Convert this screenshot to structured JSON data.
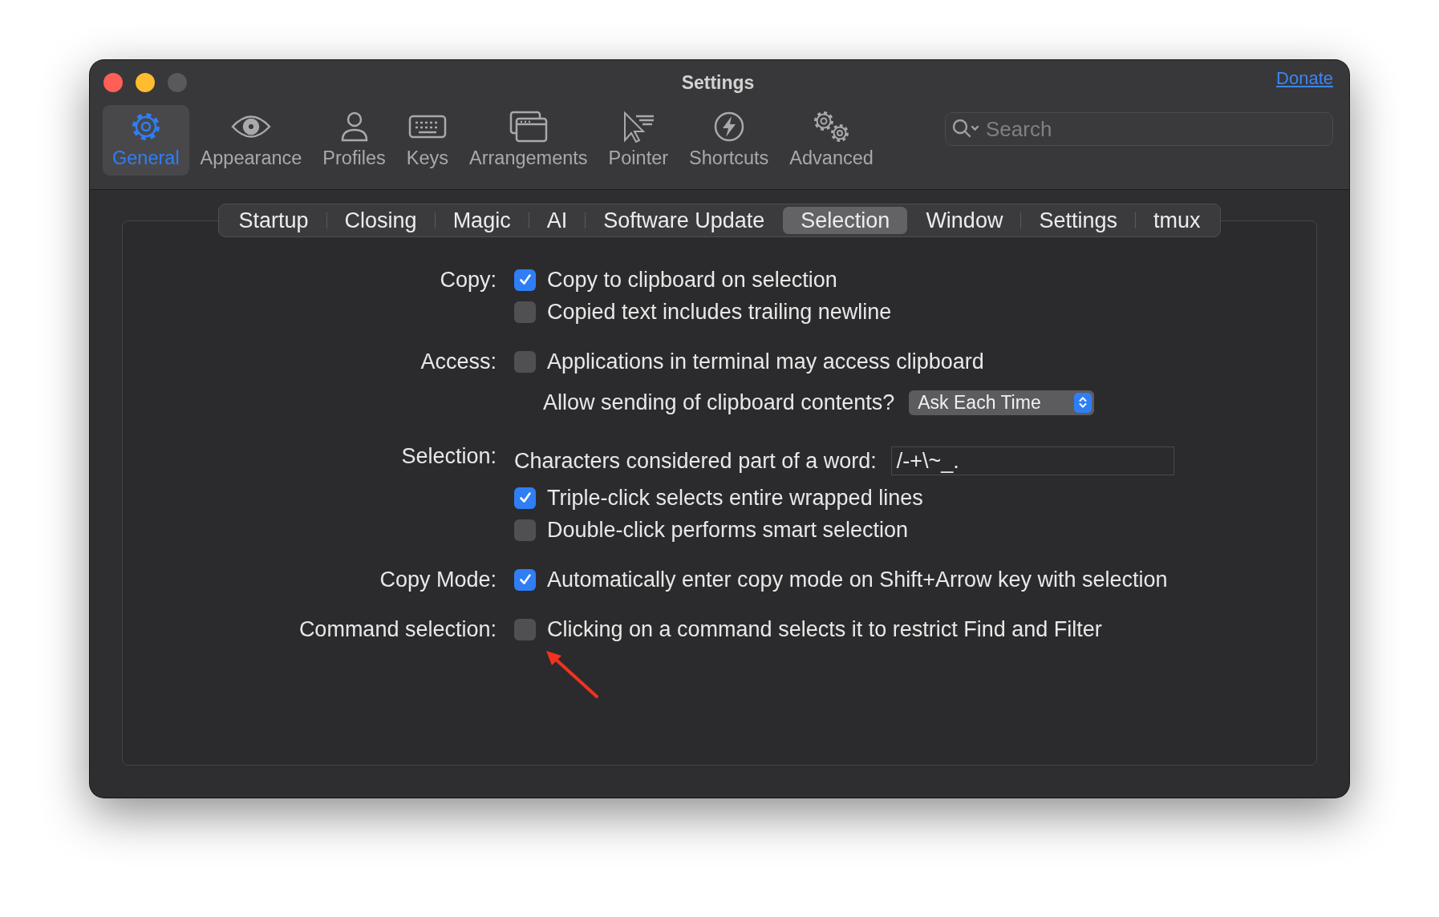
{
  "window": {
    "title": "Settings",
    "link": "Donate"
  },
  "toolbar": {
    "items": [
      {
        "label": "General",
        "selected": true
      },
      {
        "label": "Appearance",
        "selected": false
      },
      {
        "label": "Profiles",
        "selected": false
      },
      {
        "label": "Keys",
        "selected": false
      },
      {
        "label": "Arrangements",
        "selected": false
      },
      {
        "label": "Pointer",
        "selected": false
      },
      {
        "label": "Shortcuts",
        "selected": false
      },
      {
        "label": "Advanced",
        "selected": false
      }
    ],
    "search": {
      "placeholder": "Search"
    }
  },
  "tabs": [
    {
      "label": "Startup",
      "selected": false
    },
    {
      "label": "Closing",
      "selected": false
    },
    {
      "label": "Magic",
      "selected": false
    },
    {
      "label": "AI",
      "selected": false
    },
    {
      "label": "Software Update",
      "selected": false
    },
    {
      "label": "Selection",
      "selected": true
    },
    {
      "label": "Window",
      "selected": false
    },
    {
      "label": "Settings",
      "selected": false
    },
    {
      "label": "tmux",
      "selected": false
    }
  ],
  "sections": [
    {
      "label": "Copy:",
      "rows": [
        {
          "kind": "checkbox",
          "text": "Copy to clipboard on selection",
          "checked": true
        },
        {
          "kind": "checkbox",
          "text": "Copied text includes trailing newline",
          "checked": false
        }
      ]
    },
    {
      "label": "Access:",
      "rows": [
        {
          "kind": "checkbox",
          "text": "Applications in terminal may access clipboard",
          "checked": false
        },
        {
          "kind": "popup",
          "text": "Allow sending of clipboard contents?",
          "value": "Ask Each Time"
        }
      ]
    },
    {
      "label": "Selection:",
      "rows": [
        {
          "kind": "field",
          "text": "Characters considered part of a word:",
          "value": "/-+\\~_."
        },
        {
          "kind": "checkbox",
          "text": "Triple-click selects entire wrapped lines",
          "checked": true
        },
        {
          "kind": "checkbox",
          "text": "Double-click performs smart selection",
          "checked": false
        }
      ]
    },
    {
      "label": "Copy Mode:",
      "rows": [
        {
          "kind": "checkbox",
          "text": "Automatically enter copy mode on Shift+Arrow key with selection",
          "checked": true
        }
      ]
    },
    {
      "label": "Command selection:",
      "rows": [
        {
          "kind": "checkbox",
          "text": "Clicking on a command selects it to restrict Find and Filter",
          "checked": false
        }
      ]
    }
  ]
}
